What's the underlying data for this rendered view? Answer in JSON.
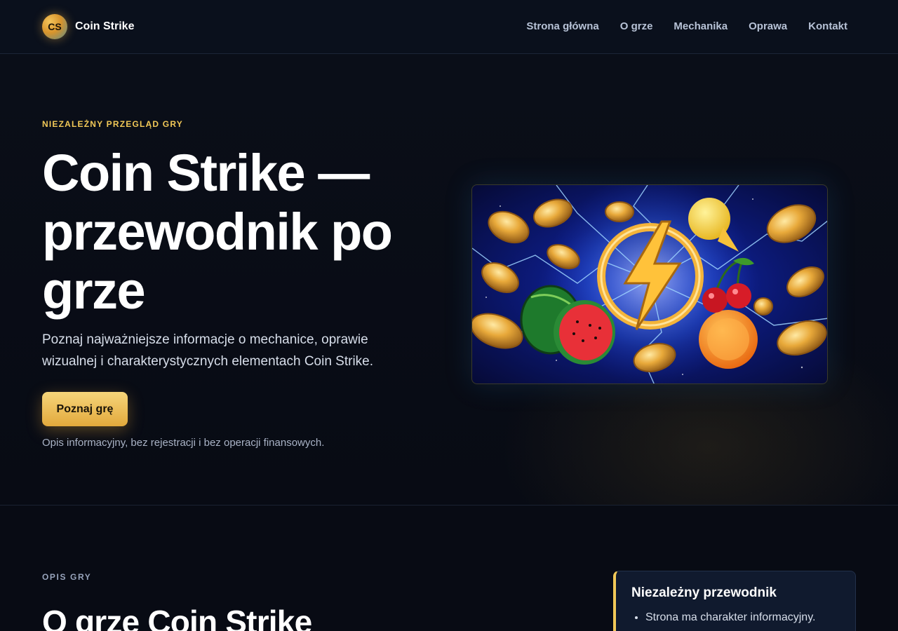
{
  "header": {
    "logo_badge": "CS",
    "brand": "Coin Strike",
    "nav": [
      "Strona główna",
      "O grze",
      "Mechanika",
      "Oprawa",
      "Kontakt"
    ]
  },
  "hero": {
    "eyebrow": "NIEZALEŻNY PRZEGLĄD GRY",
    "title": "Coin Strike — przewodnik po grze",
    "lead": "Poznaj najważniejsze informacje o mechanice, oprawie wizualnej i charakterystycznych elementach Coin Strike.",
    "cta": "Poznaj grę",
    "note": "Opis informacyjny, bez rejestracji i bez operacji finansowych."
  },
  "about": {
    "label": "OPIS GRY",
    "title": "O grze Coin Strike",
    "card_title": "Niezależny przewodnik",
    "card_items": [
      "Strona ma charakter informacyjny."
    ]
  }
}
